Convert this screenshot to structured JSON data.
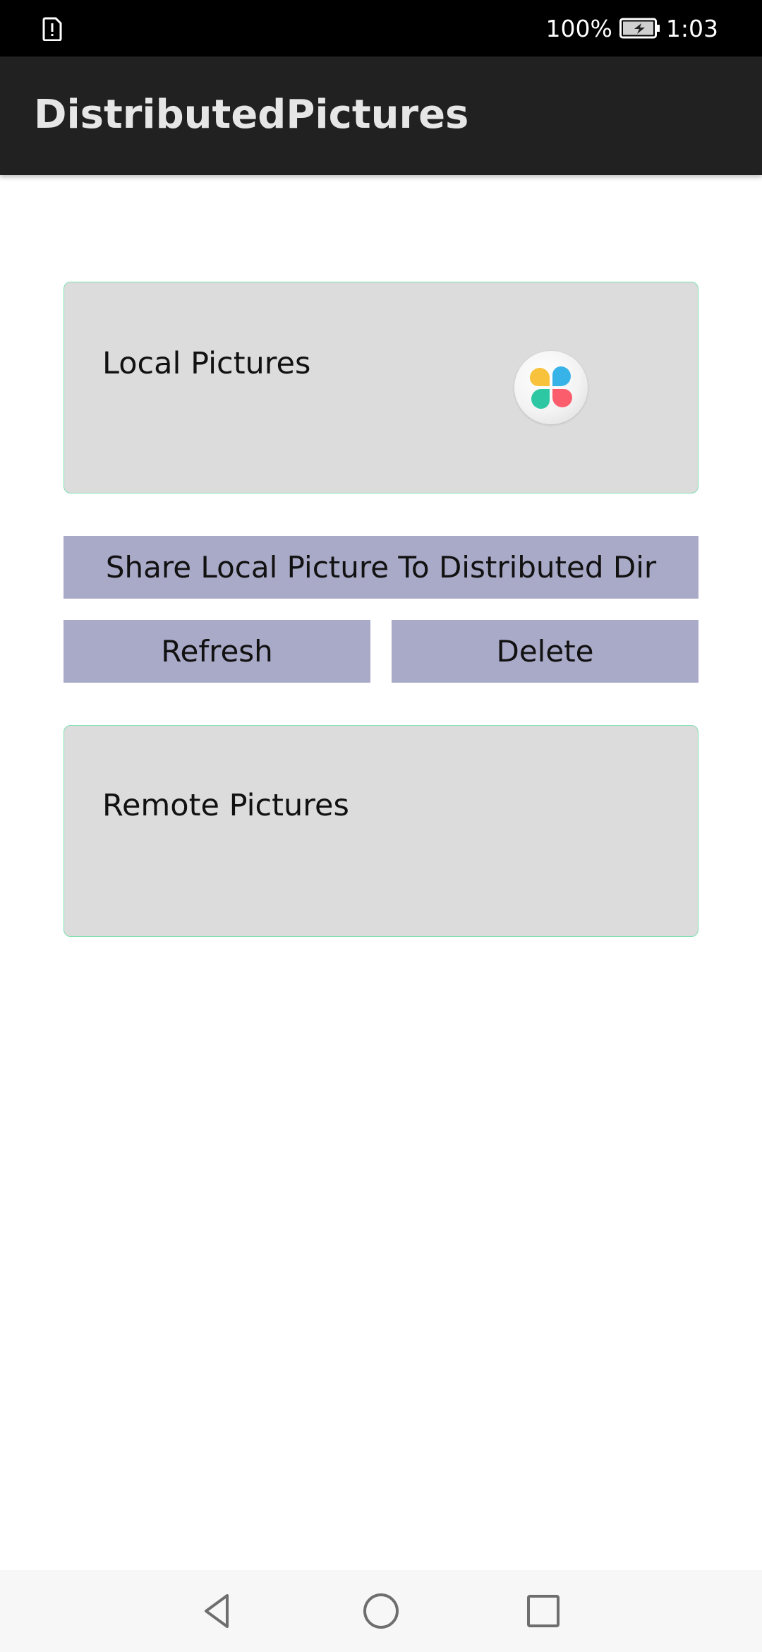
{
  "status_bar": {
    "battery_percent": "100%",
    "time": "1:03",
    "left_icon": "sim-alert-icon",
    "battery_icon": "battery-charging-icon"
  },
  "app_bar": {
    "title": "DistributedPictures"
  },
  "local_panel": {
    "label": "Local Pictures",
    "thumbnail_icon": "gallery-app-icon"
  },
  "actions": {
    "share_label": "Share Local Picture To Distributed Dir",
    "refresh_label": "Refresh",
    "delete_label": "Delete"
  },
  "remote_panel": {
    "label": "Remote Pictures"
  },
  "nav_bar": {
    "back_icon": "back-triangle-icon",
    "home_icon": "home-circle-icon",
    "recent_icon": "recent-apps-square-icon"
  },
  "colors": {
    "status_bar_bg": "#000000",
    "app_bar_bg": "#212121",
    "panel_bg": "#dcdcdc",
    "panel_border": "#7fe0b1",
    "button_bg": "#a9a9c8",
    "nav_bar_bg": "#f7f7f7"
  }
}
